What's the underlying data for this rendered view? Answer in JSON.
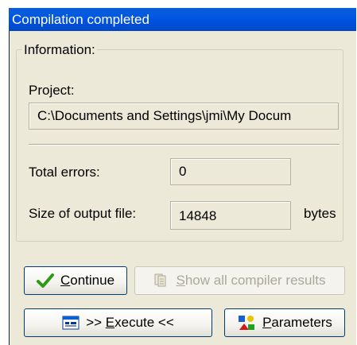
{
  "window": {
    "title": "Compilation completed"
  },
  "info_group": {
    "legend": "Information:",
    "project_label": "Project:",
    "project_path": "C:\\Documents and Settings\\jmi\\My Docum",
    "total_errors_label": "Total errors:",
    "total_errors_value": "0",
    "output_size_label": "Size of output file:",
    "output_size_value": "14848",
    "output_size_unit": "bytes"
  },
  "buttons": {
    "continue": {
      "mnemonic": "C",
      "rest": "ontinue",
      "icon": "checkmark-icon",
      "enabled": true
    },
    "show_results": {
      "prefix": "",
      "mnemonic": "S",
      "rest": "how all compiler results",
      "icon": "documents-icon",
      "enabled": false
    },
    "execute": {
      "prefix": ">> ",
      "mnemonic": "E",
      "rest": "xecute <<",
      "icon": "window-icon",
      "enabled": true
    },
    "parameters": {
      "mnemonic": "P",
      "rest": "arameters",
      "icon": "shapes-icon",
      "enabled": true
    }
  },
  "colors": {
    "titlebar": "#0055e5",
    "dialog_bg": "#ece9d8",
    "check_green": "#2d9a14"
  }
}
